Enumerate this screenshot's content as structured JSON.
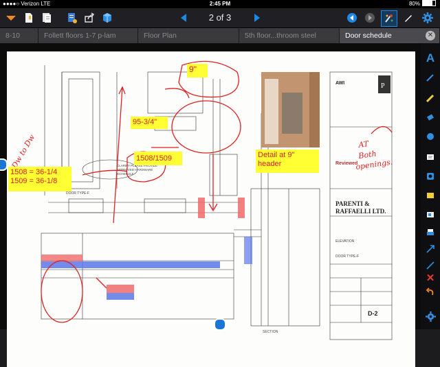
{
  "status_bar": {
    "carrier": "Verizon",
    "network": "LTE",
    "time": "2:45 PM",
    "battery": "80%"
  },
  "toolbar": {
    "page_indicator": "2 of 3"
  },
  "tabs": [
    {
      "label": "8-10",
      "active": false
    },
    {
      "label": "Follett floors 1-7 p-lam",
      "active": false
    },
    {
      "label": "Floor Plan",
      "active": false
    },
    {
      "label": "5th floor...throom steel",
      "active": false
    },
    {
      "label": "Door schedule",
      "active": true
    }
  ],
  "annotations": {
    "top_dim": "9\"",
    "width_dim": "95-3/4\"",
    "door_pair": "1508/1509",
    "dims_1508": "1508 = 36-1/4",
    "dims_1509": "1509 = 36-1/8",
    "detail_note": "Detail at 9\" header",
    "handwritten_dw": "Dw to Dw",
    "handwritten_at_both": "AT Both openings."
  },
  "drawing": {
    "company_name": "PARENTI & RAFFAELLI LTD.",
    "company_address": "215 East Prospect Avenue, Mount Prospect, IL 60056",
    "project_name": "ELEVATION",
    "sheet_title": "DOOR TYPE-F",
    "sheet_number": "D-2",
    "awi_label": "AWI",
    "door_type_label": "DOOR TYPE-F",
    "section_label": "SECTION",
    "review_title": "Reviewed",
    "clarify_note": "CLARIFY PLEASE PROVIDE APPROVED HARDWARE SCHEDULE"
  },
  "colors": {
    "markup_red": "#e02020",
    "note_yellow": "#ffff33",
    "accent_blue": "#1e88e5"
  },
  "icons": {
    "toolbar": [
      "back-arrow-icon",
      "bookmark-icon",
      "documents-icon",
      "share-icon",
      "cube-icon",
      "prev-page-icon",
      "next-page-icon",
      "undo-nav-icon",
      "redo-nav-icon",
      "markup-tools-icon",
      "pen-icon",
      "settings-icon"
    ],
    "right_bar": [
      "text-tool-icon",
      "pen-tool-icon",
      "highlighter-icon",
      "eraser-icon",
      "stamp-icon",
      "note-icon",
      "camera-icon",
      "sticky-note-icon",
      "image-icon",
      "print-icon",
      "arrow-tool-icon",
      "line-tool-icon",
      "delete-icon",
      "undo-icon",
      "settings-icon"
    ]
  }
}
